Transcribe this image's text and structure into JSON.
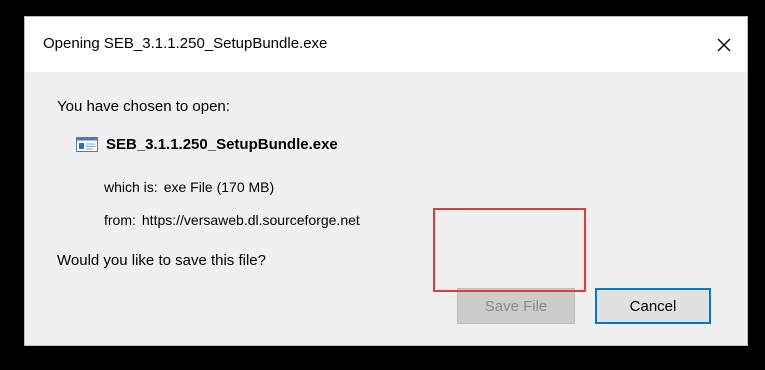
{
  "dialog": {
    "title": "Opening SEB_3.1.1.250_SetupBundle.exe",
    "close_icon": "close-icon"
  },
  "content": {
    "prompt": "You have chosen to open:",
    "file_icon": "exe-file-icon",
    "file_name": "SEB_3.1.1.250_SetupBundle.exe",
    "which_label": "which is:",
    "which_value": "exe File (170 MB)",
    "from_label": "from:",
    "from_value": "https://versaweb.dl.sourceforge.net",
    "question": "Would you like to save this file?"
  },
  "buttons": {
    "save_label": "Save File",
    "save_enabled": false,
    "cancel_label": "Cancel"
  },
  "colors": {
    "focus_border": "#0078d7",
    "highlight_border": "#e53935",
    "dialog_bg": "#f0f0f0"
  }
}
